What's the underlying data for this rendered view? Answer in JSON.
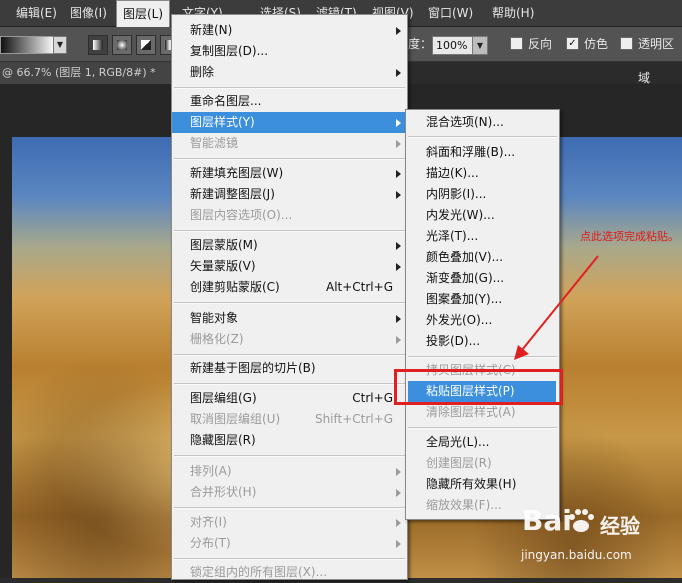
{
  "menubar": {
    "items": [
      "编辑(E)",
      "图像(I)",
      "图层(L)",
      "文字(Y)",
      "选择(S)",
      "滤镜(T)",
      "视图(V)",
      "窗口(W)",
      "帮助(H)"
    ]
  },
  "options": {
    "opacity_label": "度：",
    "opacity_value": "100%",
    "reverse_label": "反向",
    "dither_label": "仿色",
    "transparency_label": "透明区域"
  },
  "document": {
    "tab_title": "@ 66.7% (图层 1, RGB/8#) *"
  },
  "layer_menu": {
    "items": [
      {
        "label": "新建(N)",
        "shortcut": "",
        "submenu": true,
        "disabled": false
      },
      {
        "label": "复制图层(D)...",
        "shortcut": "",
        "submenu": false,
        "disabled": false
      },
      {
        "label": "删除",
        "shortcut": "",
        "submenu": true,
        "disabled": false
      },
      {
        "label": "重命名图层...",
        "shortcut": "",
        "submenu": false,
        "disabled": false
      },
      {
        "label": "图层样式(Y)",
        "shortcut": "",
        "submenu": true,
        "disabled": false,
        "highlighted": true
      },
      {
        "label": "智能滤镜",
        "shortcut": "",
        "submenu": true,
        "disabled": true
      },
      {
        "label": "新建填充图层(W)",
        "shortcut": "",
        "submenu": true,
        "disabled": false
      },
      {
        "label": "新建调整图层(J)",
        "shortcut": "",
        "submenu": true,
        "disabled": false
      },
      {
        "label": "图层内容选项(O)...",
        "shortcut": "",
        "submenu": false,
        "disabled": true
      },
      {
        "label": "图层蒙版(M)",
        "shortcut": "",
        "submenu": true,
        "disabled": false
      },
      {
        "label": "矢量蒙版(V)",
        "shortcut": "",
        "submenu": true,
        "disabled": false
      },
      {
        "label": "创建剪贴蒙版(C)",
        "shortcut": "Alt+Ctrl+G",
        "submenu": false,
        "disabled": false
      },
      {
        "label": "智能对象",
        "shortcut": "",
        "submenu": true,
        "disabled": false
      },
      {
        "label": "栅格化(Z)",
        "shortcut": "",
        "submenu": true,
        "disabled": true
      },
      {
        "label": "新建基于图层的切片(B)",
        "shortcut": "",
        "submenu": false,
        "disabled": false
      },
      {
        "label": "图层编组(G)",
        "shortcut": "Ctrl+G",
        "submenu": false,
        "disabled": false
      },
      {
        "label": "取消图层编组(U)",
        "shortcut": "Shift+Ctrl+G",
        "submenu": false,
        "disabled": true
      },
      {
        "label": "隐藏图层(R)",
        "shortcut": "",
        "submenu": false,
        "disabled": false
      },
      {
        "label": "排列(A)",
        "shortcut": "",
        "submenu": true,
        "disabled": true
      },
      {
        "label": "合并形状(H)",
        "shortcut": "",
        "submenu": true,
        "disabled": true
      },
      {
        "label": "对齐(I)",
        "shortcut": "",
        "submenu": true,
        "disabled": true
      },
      {
        "label": "分布(T)",
        "shortcut": "",
        "submenu": true,
        "disabled": true
      },
      {
        "label": "锁定组内的所有图层(X)...",
        "shortcut": "",
        "submenu": false,
        "disabled": true
      }
    ]
  },
  "style_submenu": {
    "items": [
      {
        "label": "混合选项(N)...",
        "disabled": false
      },
      {
        "label": "斜面和浮雕(B)...",
        "disabled": false
      },
      {
        "label": "描边(K)...",
        "disabled": false
      },
      {
        "label": "内阴影(I)...",
        "disabled": false
      },
      {
        "label": "内发光(W)...",
        "disabled": false
      },
      {
        "label": "光泽(T)...",
        "disabled": false
      },
      {
        "label": "颜色叠加(V)...",
        "disabled": false
      },
      {
        "label": "渐变叠加(G)...",
        "disabled": false
      },
      {
        "label": "图案叠加(Y)...",
        "disabled": false
      },
      {
        "label": "外发光(O)...",
        "disabled": false
      },
      {
        "label": "投影(D)...",
        "disabled": false
      },
      {
        "label": "拷贝图层样式(C)",
        "disabled": true
      },
      {
        "label": "粘贴图层样式(P)",
        "disabled": false,
        "highlighted": true
      },
      {
        "label": "清除图层样式(A)",
        "disabled": true
      },
      {
        "label": "全局光(L)...",
        "disabled": false
      },
      {
        "label": "创建图层(R)",
        "disabled": true
      },
      {
        "label": "隐藏所有效果(H)",
        "disabled": false
      },
      {
        "label": "缩放效果(F)...",
        "disabled": true
      }
    ]
  },
  "annotation": {
    "text": "点此选项完成粘贴。",
    "color": "#e01b1b"
  },
  "watermark": {
    "logo": "Bai",
    "brand": "经验",
    "url": "jingyan.baidu.com"
  },
  "colors": {
    "menu_highlight": "#3c8fdc",
    "annotation_red": "#e02020"
  }
}
